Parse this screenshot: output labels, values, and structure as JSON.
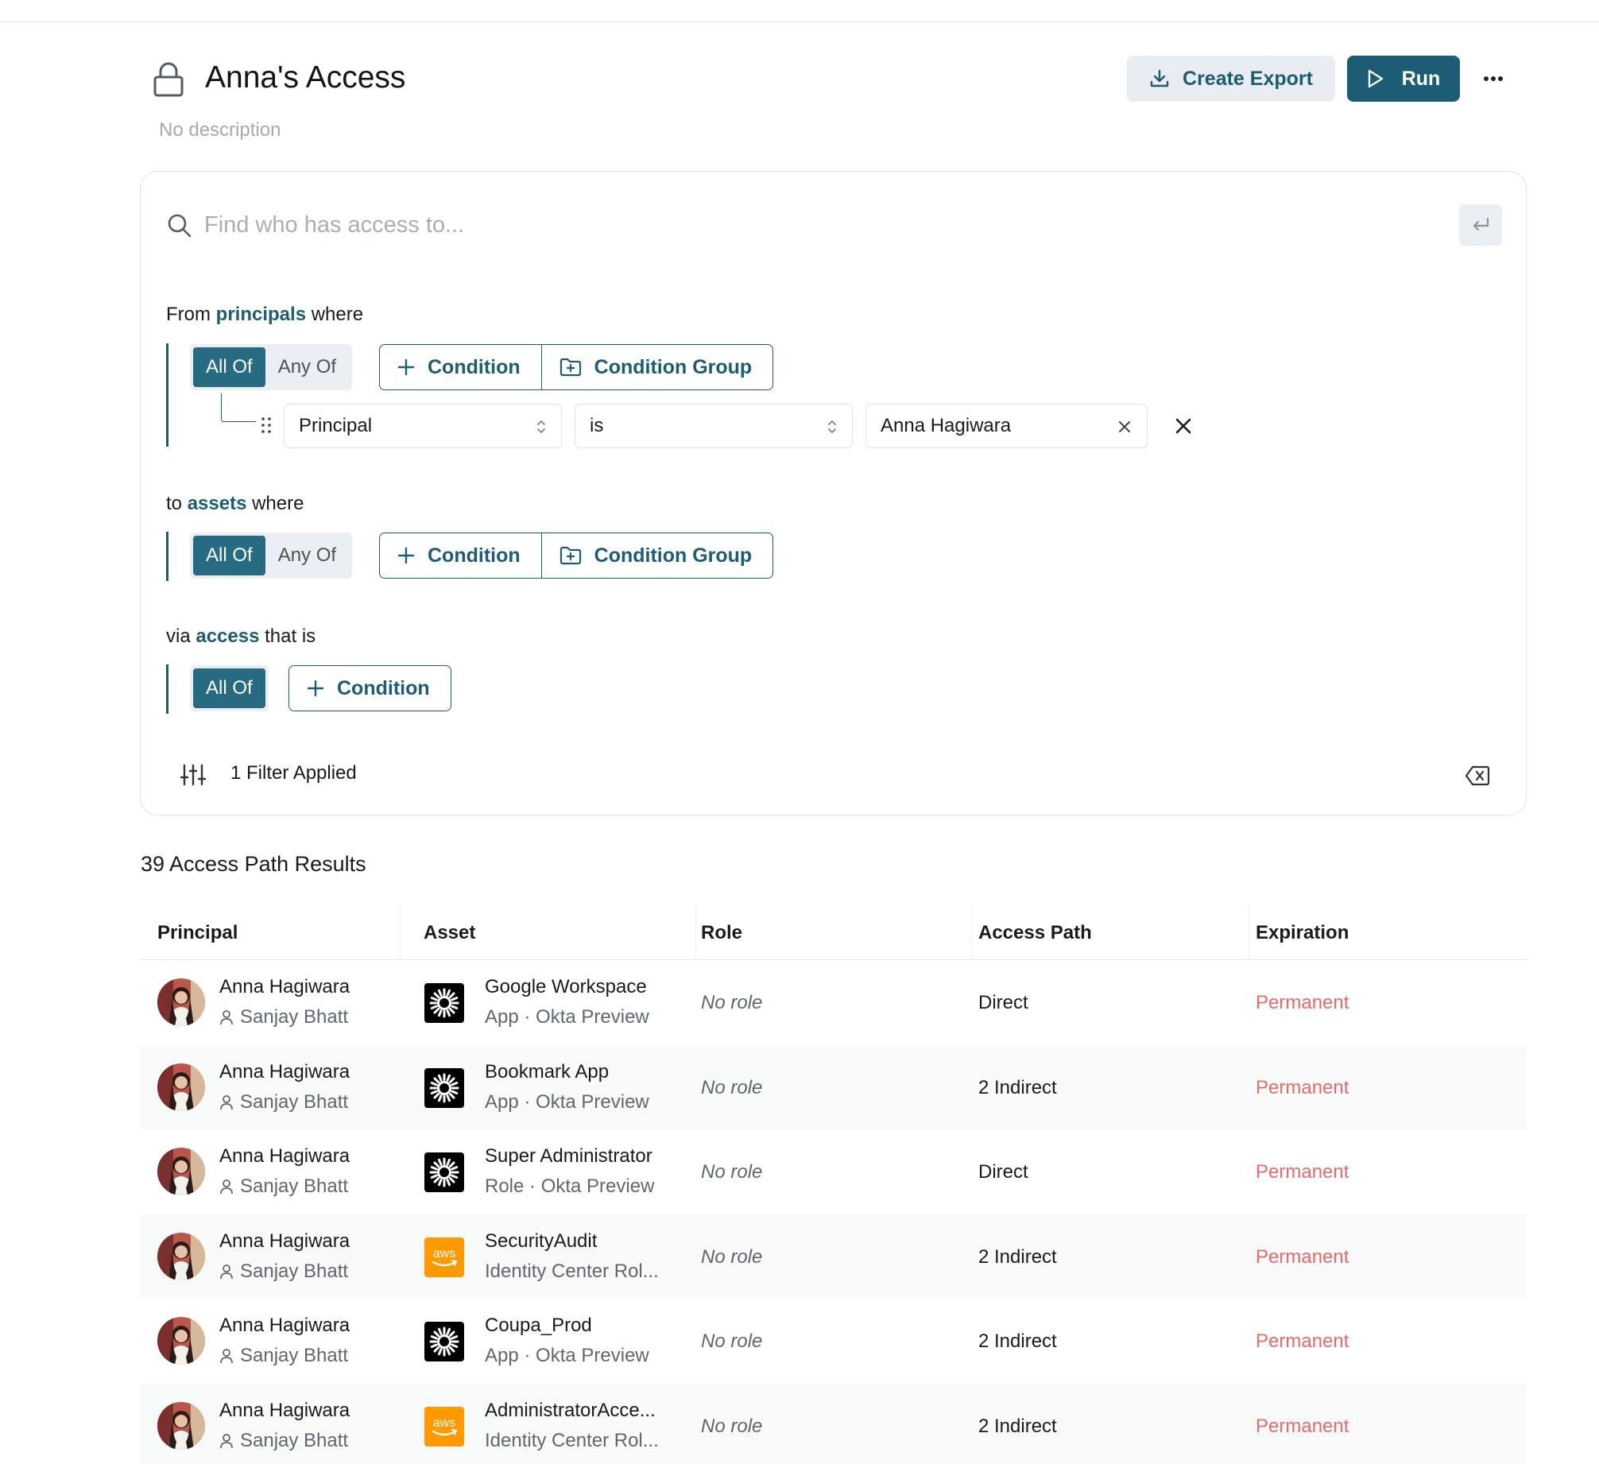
{
  "header": {
    "title": "Anna's Access",
    "description": "No description",
    "export_label": "Create Export",
    "run_label": "Run"
  },
  "search": {
    "placeholder": "Find who has access to..."
  },
  "principals": {
    "prefix": "From",
    "keyword": "principals",
    "suffix": "where",
    "all_of": "All Of",
    "any_of": "Any Of",
    "condition": "Condition",
    "condition_group": "Condition Group",
    "field": "Principal",
    "operator": "is",
    "value": "Anna Hagiwara"
  },
  "assets": {
    "prefix": "to",
    "keyword": "assets",
    "suffix": "where",
    "all_of": "All Of",
    "any_of": "Any Of",
    "condition": "Condition",
    "condition_group": "Condition Group"
  },
  "access": {
    "prefix": "via",
    "keyword": "access",
    "suffix": "that is",
    "all_of": "All Of",
    "condition": "Condition"
  },
  "filters": {
    "applied": "1 Filter Applied"
  },
  "results": {
    "title": "39 Access Path Results",
    "columns": [
      "Principal",
      "Asset",
      "Role",
      "Access Path",
      "Expiration"
    ],
    "rows": [
      {
        "principal": "Anna Hagiwara",
        "manager": "Sanjay Bhatt",
        "asset": "Google Workspace",
        "asset_sub": "App · Okta Preview",
        "logo": "okta",
        "role": "No role",
        "path": "Direct",
        "expiration": "Permanent"
      },
      {
        "principal": "Anna Hagiwara",
        "manager": "Sanjay Bhatt",
        "asset": "Bookmark App",
        "asset_sub": "App · Okta Preview",
        "logo": "okta",
        "role": "No role",
        "path": "2 Indirect",
        "expiration": "Permanent"
      },
      {
        "principal": "Anna Hagiwara",
        "manager": "Sanjay Bhatt",
        "asset": "Super Administrator",
        "asset_sub": "Role · Okta Preview",
        "logo": "okta",
        "role": "No role",
        "path": "Direct",
        "expiration": "Permanent"
      },
      {
        "principal": "Anna Hagiwara",
        "manager": "Sanjay Bhatt",
        "asset": "SecurityAudit",
        "asset_sub": "Identity Center Rol...",
        "logo": "aws",
        "role": "No role",
        "path": "2 Indirect",
        "expiration": "Permanent"
      },
      {
        "principal": "Anna Hagiwara",
        "manager": "Sanjay Bhatt",
        "asset": "Coupa_Prod",
        "asset_sub": "App · Okta Preview",
        "logo": "okta",
        "role": "No role",
        "path": "2 Indirect",
        "expiration": "Permanent"
      },
      {
        "principal": "Anna Hagiwara",
        "manager": "Sanjay Bhatt",
        "asset": "AdministratorAcce...",
        "asset_sub": "Identity Center Rol...",
        "logo": "aws",
        "role": "No role",
        "path": "2 Indirect",
        "expiration": "Permanent"
      }
    ]
  },
  "logos": {
    "aws_text": "aws"
  },
  "colors": {
    "primary": "#1c5d75",
    "expiration": "#e96a6a",
    "aws": "#ff9900"
  }
}
